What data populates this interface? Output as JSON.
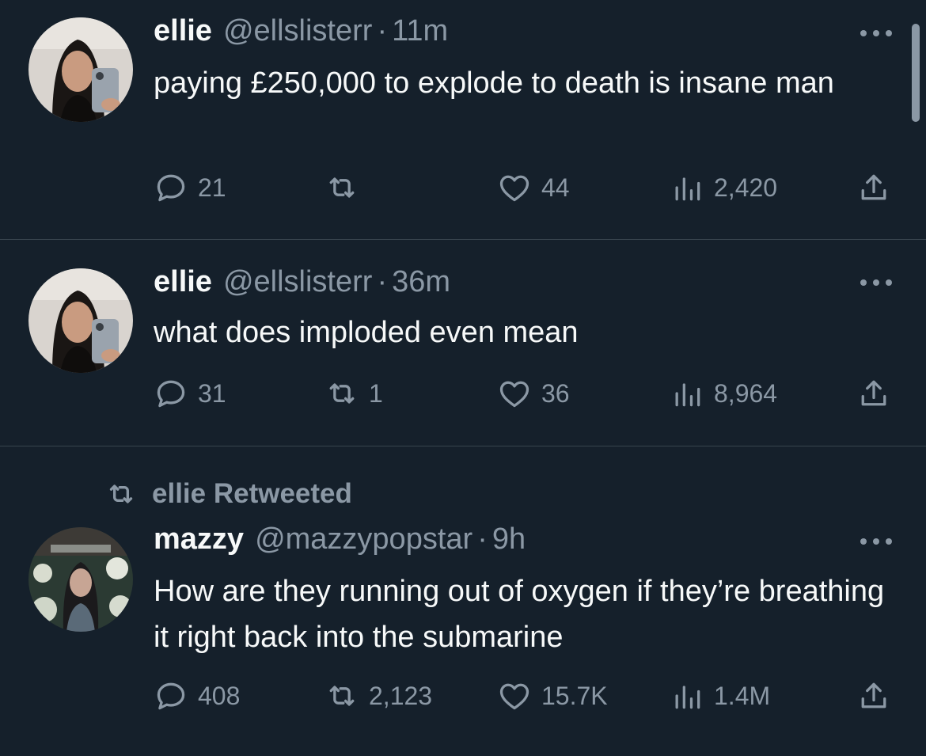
{
  "tweets": [
    {
      "name": "ellie",
      "handle": "@ellslisterr",
      "time": "11m",
      "text": "paying £250,000 to explode to death is insane man",
      "replies": "21",
      "retweets": "",
      "likes": "44",
      "views": "2,420"
    },
    {
      "name": "ellie",
      "handle": "@ellslisterr",
      "time": "36m",
      "text": "what does imploded even mean",
      "replies": "31",
      "retweets": "1",
      "likes": "36",
      "views": "8,964"
    },
    {
      "retweeted_by": "ellie Retweeted",
      "name": "mazzy",
      "handle": "@mazzypopstar",
      "time": "9h",
      "text": "How are they running out of oxygen if they’re breathing it right back into the submarine",
      "replies": "408",
      "retweets": "2,123",
      "likes": "15.7K",
      "views": "1.4M"
    }
  ],
  "separator": "·",
  "icons": {
    "reply": "reply-icon",
    "retweet": "retweet-icon",
    "like": "heart-icon",
    "views": "views-icon",
    "share": "share-icon",
    "more": "more-icon"
  },
  "colors": {
    "background": "#15202b",
    "text": "#f7f9f9",
    "secondary": "#8b98a5",
    "divider": "#38444d"
  }
}
